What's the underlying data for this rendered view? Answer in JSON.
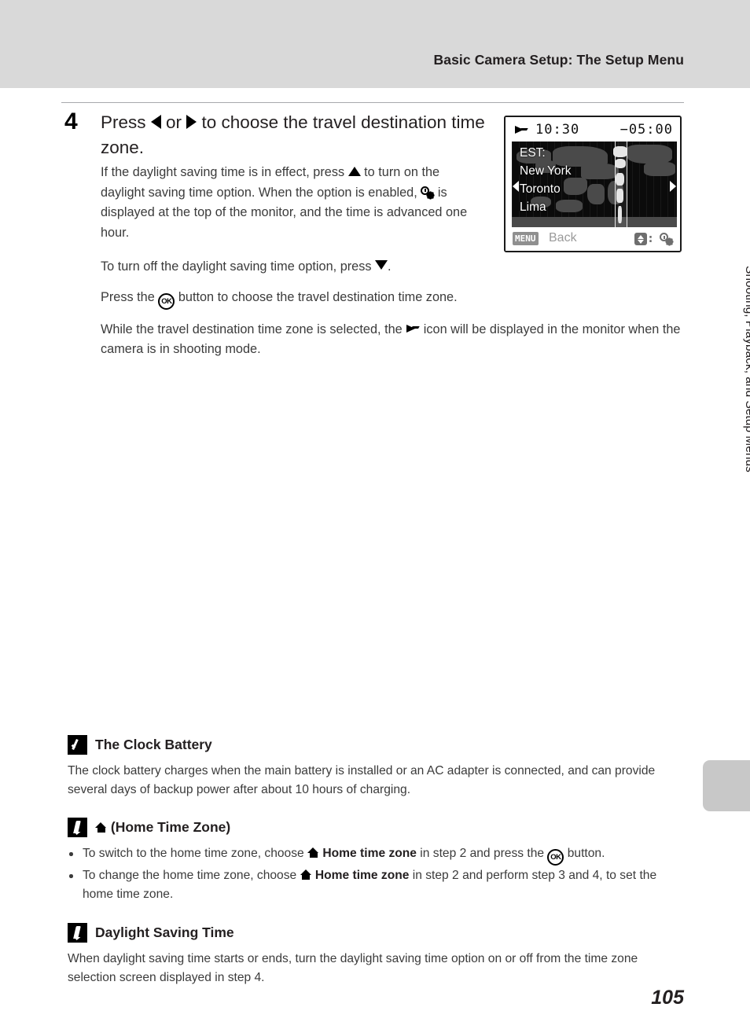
{
  "header": {
    "title": "Basic Camera Setup: The Setup Menu"
  },
  "step": {
    "number": "4",
    "heading_pre": "Press ",
    "heading_mid": " or ",
    "heading_post": " to choose the travel destination time zone.",
    "paragraph1_a": "If the daylight saving time is in effect, press ",
    "paragraph1_b": " to turn on the daylight saving time option. When the option is enabled, ",
    "paragraph1_c": " is displayed at the top of the monitor, and the time is advanced one hour.",
    "paragraph2_a": "To turn off the daylight saving time option, press ",
    "paragraph2_b": ".",
    "paragraph3_a": "Press the ",
    "paragraph3_b": " button to choose the travel destination time zone.",
    "paragraph4_a": "While the travel destination time zone is selected, the ",
    "paragraph4_b": " icon will be displayed in the monitor when the camera is in shooting mode."
  },
  "camera_screen": {
    "time": "10:30",
    "utc_offset": "−05:00",
    "zone_abbrev": "EST:",
    "city1": "New York",
    "city2": "Toronto",
    "city3": "Lima",
    "menu_chip": "MENU",
    "back_label": "Back"
  },
  "side_tab": {
    "label": "Shooting, Playback, and Setup Menus"
  },
  "notes": [
    {
      "icon": "checkmark-badge-icon",
      "title": "The Clock Battery",
      "body": "The clock battery charges when the main battery is installed or an AC adapter is connected, and can provide several days of backup power after about 10 hours of charging."
    },
    {
      "icon": "pencil-badge-icon",
      "title_suffix": "(Home Time Zone)",
      "bullet1_a": "To switch to the home time zone, choose ",
      "bullet1_b": "Home time zone",
      "bullet1_c": " in step 2 and press the ",
      "bullet1_d": " button.",
      "bullet2_a": "To change the home time zone, choose ",
      "bullet2_b": "Home time zone",
      "bullet2_c": " in step 2 and perform step 3 and 4, to set the home time zone."
    },
    {
      "icon": "pencil-badge-icon",
      "title": "Daylight Saving Time",
      "body": "When daylight saving time starts or ends, turn the daylight saving time option on or off from the time zone selection screen displayed in step 4."
    }
  ],
  "page_number": "105",
  "colors": {
    "header_band": "#d9d9d9",
    "rule": "#a7a9ac",
    "text": "#231f20",
    "body_text": "#3b3b3b",
    "side_tab_block": "#c8c8c8",
    "screen_dark": "#0b0b0b"
  }
}
